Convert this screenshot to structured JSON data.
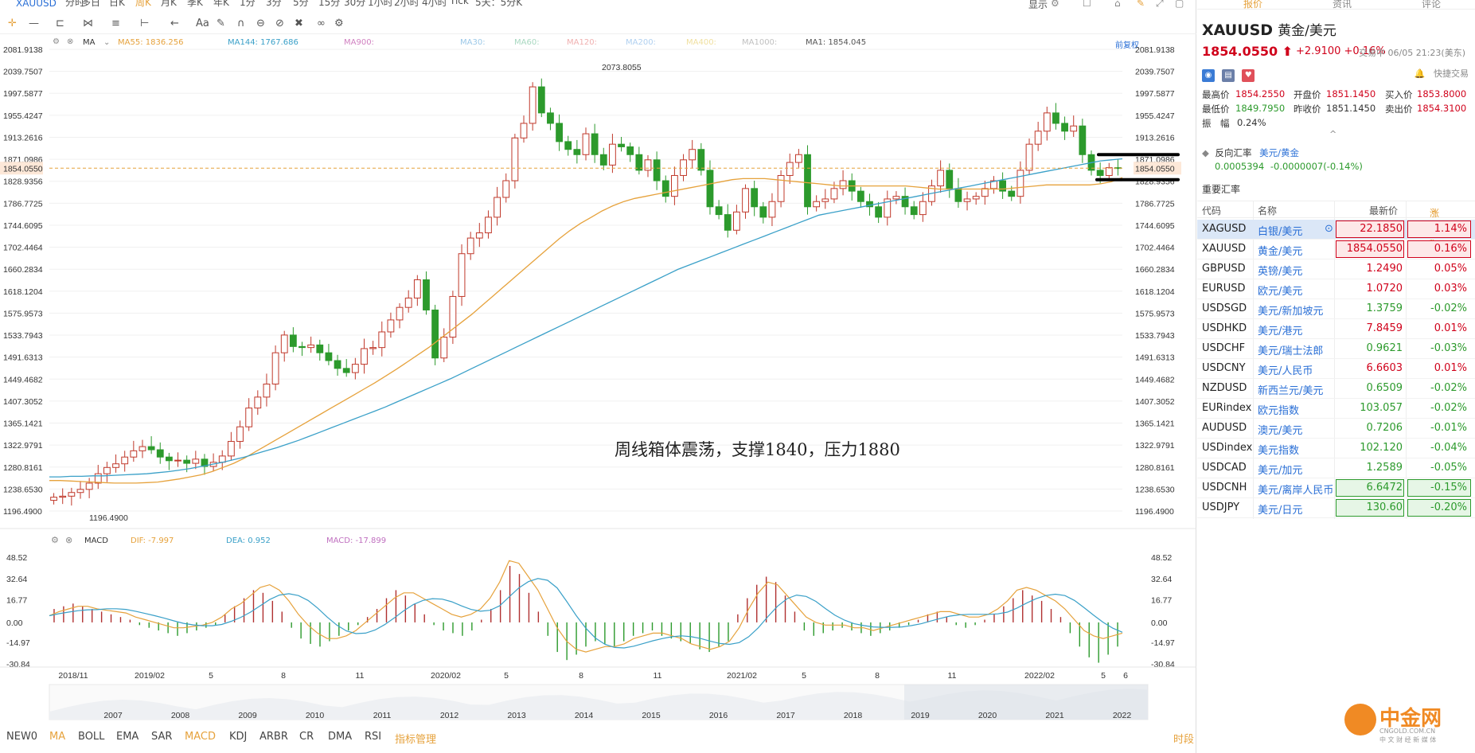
{
  "toolbar": {
    "symbol": "XAUUSD",
    "periods": [
      "分时",
      "多日",
      "日K",
      "周K",
      "月K",
      "季K",
      "年K",
      "1分",
      "3分",
      "5分",
      "15分",
      "30分",
      "1小时",
      "2小时",
      "4小时",
      "Tick",
      "5天：5分K"
    ],
    "active_period": "周K",
    "display_label": "显示"
  },
  "drawing_tools": {
    "text_tool": "Aa"
  },
  "ma_indicator": {
    "name": "MA",
    "items": [
      {
        "label": "MA55: 1836.256",
        "color": "#e6a23c"
      },
      {
        "label": "MA144: 1767.686",
        "color": "#3aa0c8"
      },
      {
        "label": "MA900:",
        "color": "#d080c0"
      },
      {
        "label": "MA30:",
        "color": "#9bc8e8"
      },
      {
        "label": "MA60:",
        "color": "#a8d8c0"
      },
      {
        "label": "MA120:",
        "color": "#f0b0b0"
      },
      {
        "label": "MA200:",
        "color": "#b0d0f0"
      },
      {
        "label": "MA400:",
        "color": "#f0e0a0"
      },
      {
        "label": "MA1000:",
        "color": "#c0c0c0"
      },
      {
        "label": "MA1: 1854.045",
        "color": "#555555"
      }
    ],
    "restore_label": "前复权"
  },
  "chart_data": [
    {
      "type": "candlestick",
      "title": "",
      "annotation": "周线箱体震荡，支撑1840，压力1880",
      "y_ticks": [
        "2081.9138",
        "2039.7507",
        "1997.5877",
        "1955.4247",
        "1913.2616",
        "1871.0986",
        "1828.9356",
        "1786.7725",
        "1744.6095",
        "1702.4464",
        "1660.2834",
        "1618.1204",
        "1575.9573",
        "1533.7943",
        "1491.6313",
        "1449.4682",
        "1407.3052",
        "1365.1421",
        "1322.9791",
        "1280.8161",
        "1238.6530",
        "1196.4900"
      ],
      "ylim": [
        1196.49,
        2081.9138
      ],
      "current_price": "1854.0550",
      "max_label": "2073.8055",
      "min_label": "1196.4900",
      "x_ticks": [
        "2018/11",
        "2019/02",
        "5",
        "8",
        "11",
        "2020/02",
        "5",
        "8",
        "11",
        "2021/02",
        "5",
        "8",
        "11",
        "2022/02",
        "5",
        "6"
      ],
      "ma_series": [
        {
          "name": "MA55",
          "color": "#e6a23c"
        },
        {
          "name": "MA144",
          "color": "#3aa0c8"
        }
      ],
      "closes": [
        1223,
        1225,
        1232,
        1238,
        1250,
        1268,
        1280,
        1287,
        1300,
        1312,
        1320,
        1314,
        1300,
        1293,
        1294,
        1288,
        1296,
        1282,
        1290,
        1302,
        1330,
        1358,
        1394,
        1415,
        1440,
        1500,
        1534,
        1512,
        1510,
        1515,
        1500,
        1485,
        1470,
        1462,
        1478,
        1508,
        1510,
        1540,
        1563,
        1587,
        1605,
        1640,
        1582,
        1490,
        1530,
        1608,
        1690,
        1720,
        1730,
        1760,
        1798,
        1830,
        1912,
        1940,
        2010,
        1960,
        1940,
        1905,
        1890,
        1880,
        1920,
        1880,
        1860,
        1900,
        1895,
        1880,
        1850,
        1870,
        1830,
        1800,
        1840,
        1870,
        1890,
        1850,
        1780,
        1765,
        1735,
        1770,
        1815,
        1780,
        1760,
        1790,
        1840,
        1865,
        1880,
        1780,
        1790,
        1795,
        1815,
        1830,
        1810,
        1790,
        1780,
        1760,
        1795,
        1800,
        1780,
        1765,
        1790,
        1820,
        1850,
        1815,
        1790,
        1795,
        1800,
        1815,
        1830,
        1810,
        1800,
        1850,
        1900,
        1925,
        1960,
        1940,
        1925,
        1935,
        1880,
        1850,
        1840,
        1855,
        1854
      ],
      "ma55": [
        1255,
        1255,
        1254,
        1253,
        1252,
        1251,
        1250,
        1250,
        1250,
        1251,
        1252,
        1255,
        1258,
        1262,
        1266,
        1272,
        1280,
        1288,
        1298,
        1310,
        1322,
        1334,
        1346,
        1358,
        1370,
        1382,
        1394,
        1406,
        1418,
        1430,
        1442,
        1455,
        1468,
        1482,
        1496,
        1510,
        1526,
        1542,
        1558,
        1574,
        1592,
        1610,
        1628,
        1646,
        1664,
        1682,
        1700,
        1718,
        1734,
        1748,
        1760,
        1772,
        1782,
        1790,
        1796,
        1800,
        1804,
        1808,
        1812,
        1816,
        1820,
        1824,
        1828,
        1832,
        1834,
        1834,
        1834,
        1832,
        1830,
        1828,
        1826,
        1824,
        1822,
        1820,
        1820,
        1820,
        1820,
        1820,
        1820,
        1820,
        1818,
        1816,
        1814,
        1814,
        1814,
        1814,
        1814,
        1814,
        1814,
        1816,
        1818,
        1820,
        1822,
        1822,
        1822,
        1822,
        1822,
        1824,
        1828,
        1836
      ],
      "ma144": [
        1262,
        1262,
        1263,
        1263,
        1264,
        1264,
        1265,
        1266,
        1267,
        1268,
        1270,
        1272,
        1275,
        1278,
        1282,
        1286,
        1290,
        1295,
        1300,
        1306,
        1312,
        1318,
        1325,
        1332,
        1340,
        1348,
        1356,
        1364,
        1372,
        1380,
        1388,
        1396,
        1405,
        1414,
        1423,
        1432,
        1441,
        1450,
        1460,
        1470,
        1480,
        1490,
        1500,
        1510,
        1520,
        1530,
        1540,
        1550,
        1560,
        1570,
        1580,
        1590,
        1600,
        1610,
        1620,
        1630,
        1640,
        1650,
        1660,
        1668,
        1676,
        1684,
        1692,
        1700,
        1708,
        1716,
        1724,
        1732,
        1740,
        1748,
        1756,
        1764,
        1768,
        1772,
        1776,
        1780,
        1784,
        1788,
        1792,
        1796,
        1800,
        1804,
        1808,
        1812,
        1816,
        1820,
        1824,
        1828,
        1832,
        1836,
        1840,
        1844,
        1848,
        1852,
        1856,
        1860,
        1864,
        1868,
        1870,
        1872
      ]
    },
    {
      "type": "bar",
      "title": "",
      "indicator": "MACD",
      "legend": [
        {
          "label": "DIF: -7.997",
          "color": "#e6a23c"
        },
        {
          "label": "DEA: 0.952",
          "color": "#3aa0c8"
        },
        {
          "label": "MACD: -17.899",
          "color": "#c070c0"
        }
      ],
      "y_ticks": [
        "48.52",
        "32.64",
        "16.77",
        "0.00",
        "-14.97",
        "-30.84"
      ],
      "ylim": [
        -30.84,
        48.52
      ],
      "hist": [
        10,
        12,
        14,
        12,
        10,
        8,
        6,
        4,
        2,
        -2,
        -4,
        -6,
        -8,
        -10,
        -8,
        -6,
        -4,
        -2,
        6,
        12,
        18,
        24,
        22,
        16,
        8,
        -4,
        -12,
        -16,
        -18,
        -14,
        -10,
        -6,
        -2,
        4,
        10,
        18,
        24,
        20,
        14,
        6,
        -2,
        -6,
        -8,
        -10,
        -6,
        2,
        10,
        24,
        42,
        36,
        22,
        8,
        -10,
        -22,
        -28,
        -24,
        -18,
        -14,
        -16,
        -18,
        -14,
        -10,
        -8,
        -6,
        -10,
        -12,
        -14,
        -16,
        -20,
        -22,
        -18,
        -14,
        6,
        18,
        28,
        34,
        30,
        20,
        8,
        -6,
        -10,
        -8,
        -6,
        -4,
        -6,
        -8,
        -10,
        -8,
        -6,
        -4,
        -2,
        2,
        6,
        8,
        4,
        -2,
        -4,
        -2,
        2,
        6,
        12,
        18,
        24,
        20,
        16,
        10,
        4,
        -8,
        -18,
        -26,
        -30,
        -24,
        -18
      ],
      "dif": [
        5,
        8,
        10,
        12,
        12,
        10,
        9,
        8,
        7,
        4,
        2,
        0,
        -2,
        -4,
        -4,
        -3,
        -2,
        0,
        4,
        10,
        14,
        20,
        26,
        28,
        24,
        16,
        6,
        -2,
        -8,
        -12,
        -12,
        -10,
        -6,
        0,
        6,
        12,
        18,
        22,
        22,
        18,
        14,
        10,
        6,
        4,
        6,
        10,
        18,
        30,
        46,
        44,
        34,
        24,
        10,
        -4,
        -14,
        -20,
        -22,
        -20,
        -18,
        -18,
        -16,
        -12,
        -10,
        -8,
        -8,
        -10,
        -12,
        -16,
        -18,
        -20,
        -18,
        -14,
        -4,
        10,
        22,
        30,
        28,
        20,
        12,
        4,
        0,
        -2,
        -2,
        -2,
        -4,
        -4,
        -6,
        -4,
        -2,
        0,
        2,
        4,
        6,
        8,
        8,
        6,
        4,
        4,
        6,
        10,
        16,
        24,
        26,
        24,
        20,
        16,
        10,
        2,
        -6,
        -10,
        -12,
        -10,
        -8
      ]
    }
  ],
  "timeline": {
    "years": [
      "2007",
      "2008",
      "2009",
      "2010",
      "2011",
      "2012",
      "2013",
      "2014",
      "2015",
      "2016",
      "2017",
      "2018",
      "2019",
      "2020",
      "2021",
      "2022"
    ]
  },
  "indicator_tabs": {
    "items": [
      "NEW0",
      "MA",
      "BOLL",
      "EMA",
      "SAR",
      "MACD",
      "KDJ",
      "ARBR",
      "CR",
      "DMA",
      "RSI",
      "指标管理"
    ],
    "right_label": "时段"
  },
  "side_panel": {
    "tabs": [
      "报价",
      "资讯",
      "评论"
    ],
    "symbol": "XAUUSD",
    "name": "黄金/美元",
    "price": "1854.0550",
    "change": "+2.9100",
    "change_pct": "+0.16%",
    "status": "交易中 06/05 21:23(美东)",
    "quick_trade": "快捷交易",
    "stats": {
      "high_label": "最高价",
      "high": "1854.2550",
      "open_label": "开盘价",
      "open": "1851.1450",
      "bid_label": "买入价",
      "bid": "1853.8000",
      "low_label": "最低价",
      "low": "1849.7950",
      "prev_label": "昨收价",
      "prev": "1851.1450",
      "ask_label": "卖出价",
      "ask": "1854.3100",
      "amp_label": "振　幅",
      "amp": "0.24%"
    },
    "reverse": {
      "label": "反向汇率",
      "pair": "美元/黄金",
      "value": "0.0005394",
      "change": "-0.0000007(-0.14%)"
    },
    "section_title": "重要汇率",
    "table_headers": [
      "代码",
      "名称",
      "最新价",
      "涨跌幅"
    ],
    "rows": [
      {
        "code": "XAGUSD",
        "name": "白银/美元",
        "price": "22.1850",
        "pct": "1.14%",
        "dir": "up",
        "boxed": true,
        "selected": true
      },
      {
        "code": "XAUUSD",
        "name": "黄金/美元",
        "price": "1854.0550",
        "pct": "0.16%",
        "dir": "up",
        "boxed": true,
        "selected": false
      },
      {
        "code": "GBPUSD",
        "name": "英镑/美元",
        "price": "1.2490",
        "pct": "0.05%",
        "dir": "up",
        "boxed": false,
        "selected": false
      },
      {
        "code": "EURUSD",
        "name": "欧元/美元",
        "price": "1.0720",
        "pct": "0.03%",
        "dir": "up",
        "boxed": false,
        "selected": false
      },
      {
        "code": "USDSGD",
        "name": "美元/新加坡元",
        "price": "1.3759",
        "pct": "-0.02%",
        "dir": "dn",
        "boxed": false,
        "selected": false
      },
      {
        "code": "USDHKD",
        "name": "美元/港元",
        "price": "7.8459",
        "pct": "0.01%",
        "dir": "up",
        "boxed": false,
        "selected": false
      },
      {
        "code": "USDCHF",
        "name": "美元/瑞士法郎",
        "price": "0.9621",
        "pct": "-0.03%",
        "dir": "dn",
        "boxed": false,
        "selected": false
      },
      {
        "code": "USDCNY",
        "name": "美元/人民币",
        "price": "6.6603",
        "pct": "0.01%",
        "dir": "up",
        "boxed": false,
        "selected": false
      },
      {
        "code": "NZDUSD",
        "name": "新西兰元/美元",
        "price": "0.6509",
        "pct": "-0.02%",
        "dir": "dn",
        "boxed": false,
        "selected": false
      },
      {
        "code": "EURindex",
        "name": "欧元指数",
        "price": "103.057",
        "pct": "-0.02%",
        "dir": "dn",
        "boxed": false,
        "selected": false
      },
      {
        "code": "AUDUSD",
        "name": "澳元/美元",
        "price": "0.7206",
        "pct": "-0.01%",
        "dir": "dn",
        "boxed": false,
        "selected": false
      },
      {
        "code": "USDindex",
        "name": "美元指数",
        "price": "102.120",
        "pct": "-0.04%",
        "dir": "dn",
        "boxed": false,
        "selected": false
      },
      {
        "code": "USDCAD",
        "name": "美元/加元",
        "price": "1.2589",
        "pct": "-0.05%",
        "dir": "dn",
        "boxed": false,
        "selected": false
      },
      {
        "code": "USDCNH",
        "name": "美元/离岸人民币",
        "price": "6.6472",
        "pct": "-0.15%",
        "dir": "dn",
        "boxed": true,
        "selected": false
      },
      {
        "code": "USDJPY",
        "name": "美元/日元",
        "price": "130.60",
        "pct": "-0.20%",
        "dir": "dn",
        "boxed": true,
        "selected": false
      }
    ],
    "logo": {
      "name": "中金网",
      "url_text": "CNGOLD.COM.CN",
      "tagline": "中 文 财 经 新 媒 体"
    }
  }
}
